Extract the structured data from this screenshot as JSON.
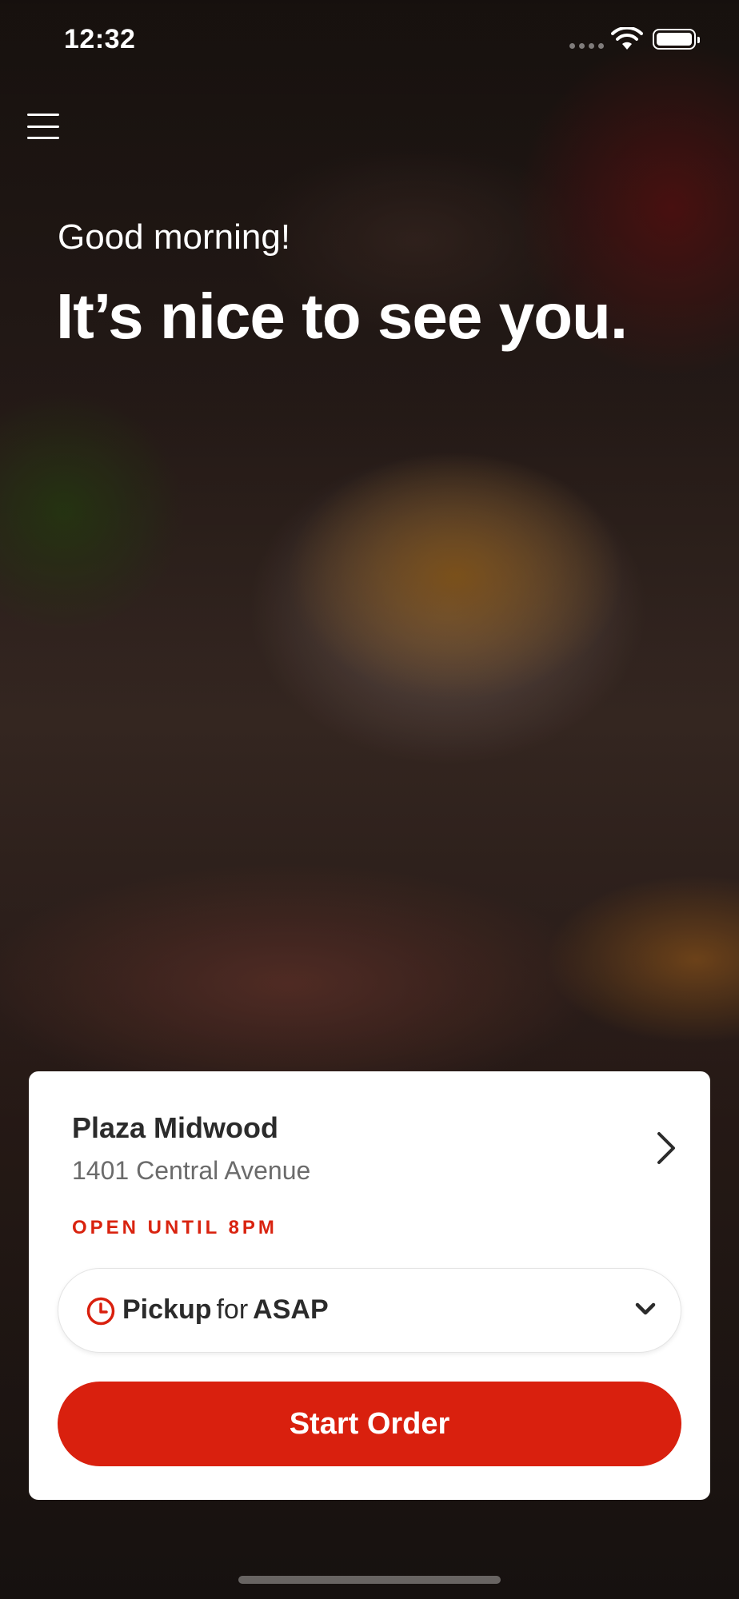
{
  "status_bar": {
    "time": "12:32"
  },
  "hero": {
    "greeting": "Good morning!",
    "headline": "It’s nice to see you."
  },
  "location": {
    "name": "Plaza Midwood",
    "address": "1401 Central Avenue",
    "status": "OPEN UNTIL 8PM"
  },
  "order_mode": {
    "mode": "Pickup",
    "connector": "for",
    "time": "ASAP"
  },
  "actions": {
    "start_order_label": "Start Order"
  },
  "icons": {
    "menu": "hamburger-menu-icon",
    "location_arrow": "chevron-right-icon",
    "time": "clock-icon",
    "dropdown": "chevron-down-icon"
  },
  "colors": {
    "accent": "#D9200E",
    "text_dark": "#2B2B2B",
    "text_muted": "#6B6B6B"
  }
}
